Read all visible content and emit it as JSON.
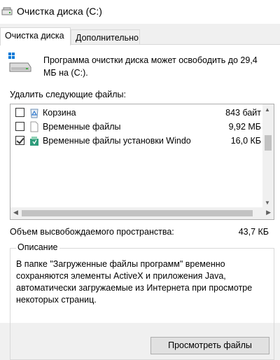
{
  "window": {
    "title": "Очистка диска  (C:)"
  },
  "tabs": [
    {
      "label": "Очистка диска",
      "active": true
    },
    {
      "label": "Дополнительно",
      "active": false
    }
  ],
  "intro_text": "Программа очистки диска может освободить до 29,4 МБ на  (C:).",
  "delete_files_label": "Удалить следующие файлы:",
  "files": [
    {
      "name": "Корзина",
      "size": "843 байт",
      "checked": false,
      "icon": "recycle-bin-icon"
    },
    {
      "name": "Временные файлы",
      "size": "9,92 МБ",
      "checked": false,
      "icon": "blank-file-icon"
    },
    {
      "name": "Временные файлы установки Windo",
      "size": "16,0 КБ",
      "checked": true,
      "icon": "setup-files-icon"
    }
  ],
  "space_label": "Объем высвобождаемого пространства:",
  "space_value": "43,7 КБ",
  "description": {
    "legend": "Описание",
    "text": "В папке \"Загруженные файлы программ\" временно сохраняются элементы ActiveX и приложения Java, автоматически загружаемые из Интернета при просмотре некоторых страниц."
  },
  "buttons": {
    "view_files": "Просмотреть файлы"
  },
  "colors": {
    "accent": "#0078d7",
    "window_bg": "#f0f0f0",
    "panel_bg": "#ffffff"
  }
}
